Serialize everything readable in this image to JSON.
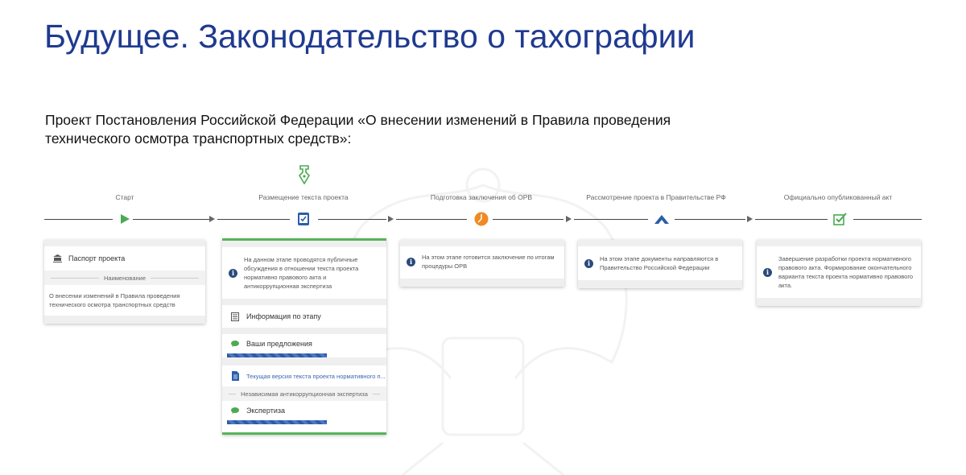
{
  "slide": {
    "title": "Будущее. Законодательство о тахографии",
    "subtitle": "Проект Постановления Российской Федерации «О внесении изменений в Правила проведения технического осмотра транспортных средств»:"
  },
  "stages": [
    {
      "label": "Старт",
      "icon": "play-icon"
    },
    {
      "label": "Размещение текста проекта",
      "icon": "checkbox-doc-icon"
    },
    {
      "label": "Подготовка заключения об ОРВ",
      "icon": "pie-clock-icon"
    },
    {
      "label": "Рассмотрение проекта в Правительстве РФ",
      "icon": "chevron-up-icon"
    },
    {
      "label": "Официально опубликованный акт",
      "icon": "check-square-icon"
    }
  ],
  "top_icon": "pen-icon",
  "card_start": {
    "passport_label": "Паспорт проекта",
    "name_header": "Наименование",
    "name_value": "О внесении изменений в Правила проведения технического осмотра транспортных средств"
  },
  "card_placement": {
    "info": "На данном этапе проводятся публичные обсуждения в отношении текста проекта нормативно правового акта и антикоррупционная экспертиза",
    "stage_info_label": "Информация по этапу",
    "proposals_label": "Ваши предложения",
    "current_version_label": "Текущая версия текста проекта нормативного п...",
    "independent_header": "Независимая антикоррупционная экспертиза",
    "expertise_label": "Экспертиза"
  },
  "card_orv": {
    "info": "На этом этапе готовится заключение по итогам процедуры ОРВ"
  },
  "card_gov": {
    "info": "На этом этапе документы направляются в Правительство Российской Федерации"
  },
  "card_published": {
    "info": "Завершение разработки проекта нормативного правового акта. Формирование окончательного варианта текста проекта нормативно правового акта."
  },
  "colors": {
    "title": "#1f3a8f",
    "green": "#57b35a",
    "blue": "#2b4a7c",
    "orange": "#f08a24"
  }
}
